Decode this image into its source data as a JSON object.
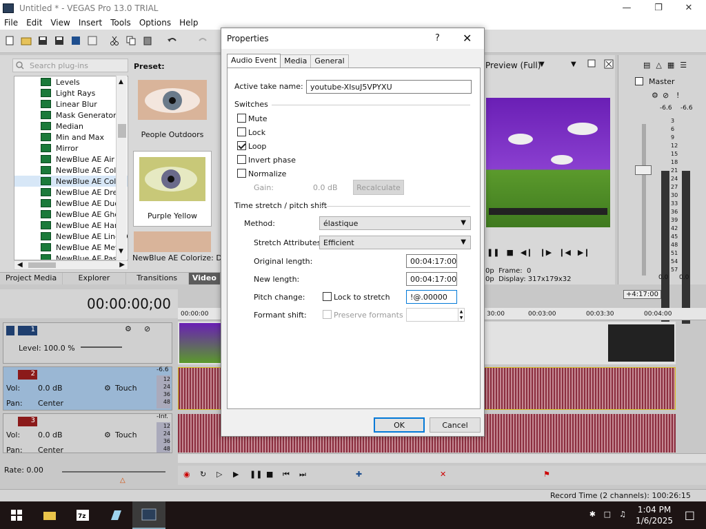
{
  "window": {
    "title": "Untitled * - VEGAS Pro 13.0 TRIAL"
  },
  "menu": [
    "File",
    "Edit",
    "View",
    "Insert",
    "Tools",
    "Options",
    "Help"
  ],
  "plugins": {
    "search_placeholder": "Search plug-ins",
    "items": [
      "Levels",
      "Light Rays",
      "Linear Blur",
      "Mask Generator",
      "Median",
      "Min and Max",
      "Mirror",
      "NewBlue AE Air Br",
      "NewBlue AE Color",
      "NewBlue AE Color",
      "NewBlue AE Drear",
      "NewBlue AE DuoC",
      "NewBlue AE Ghos",
      "NewBlue AE Hand",
      "NewBlue AE Line D",
      "NewBlue AE Metal",
      "NewBlue AE Paste"
    ],
    "selected_index": 9
  },
  "preset": {
    "label": "Preset:",
    "items": [
      "People Outdoors",
      "Purple Yellow"
    ],
    "status": "NewBlue AE Colorize: DXT,"
  },
  "left_tabs": [
    "Project Media",
    "Explorer",
    "Transitions",
    "Video"
  ],
  "preview": {
    "mode": "Preview (Full)",
    "line1": "0p  Frame:  0",
    "line2": "0p  Display: 317x179x32"
  },
  "master": {
    "label": "Master",
    "left_db": "-6.6",
    "right_db": "-6.6",
    "scale": [
      "3",
      "6",
      "9",
      "12",
      "15",
      "18",
      "21",
      "24",
      "27",
      "30",
      "33",
      "36",
      "39",
      "42",
      "45",
      "48",
      "51",
      "54",
      "57"
    ],
    "bottom_left": "0.0",
    "bottom_right": "0.0"
  },
  "timeline": {
    "timecode": "00:00:00;00",
    "end_marker": "+4:17:00",
    "ruler": [
      "00:00:00",
      "30:00",
      "00:03:00",
      "00:03:30",
      "00:04:00"
    ],
    "tracks": [
      {
        "num": "1",
        "level": "Level: 100.0 %"
      },
      {
        "num": "2",
        "vol": "Vol:",
        "vol_val": "0.0 dB",
        "pan": "Pan:",
        "pan_val": "Center",
        "mode": "Touch",
        "peak": "-6.6"
      },
      {
        "num": "3",
        "vol": "Vol:",
        "vol_val": "0.0 dB",
        "pan": "Pan:",
        "pan_val": "Center",
        "mode": "Touch",
        "peak": "-Inf."
      }
    ],
    "meter_marks": [
      "12",
      "24",
      "36",
      "48"
    ],
    "rate": "Rate: 0.00",
    "record_time": "Record Time (2 channels): 100:26:15"
  },
  "dialog": {
    "title": "Properties",
    "help": "?",
    "close": "✕",
    "tabs": [
      "Audio Event",
      "Media",
      "General"
    ],
    "active_take_label": "Active take name:",
    "active_take_value": "youtube-XIsuJ5VPYXU",
    "switches_label": "Switches",
    "switches": [
      {
        "label": "Mute",
        "checked": false
      },
      {
        "label": "Lock",
        "checked": false
      },
      {
        "label": "Loop",
        "checked": true
      },
      {
        "label": "Invert phase",
        "checked": false
      },
      {
        "label": "Normalize",
        "checked": false
      }
    ],
    "gain_label": "Gain:",
    "gain_value": "0.0 dB",
    "recalc": "Recalculate",
    "stretch_label": "Time stretch / pitch shift",
    "method_label": "Method:",
    "method_value": "élastique",
    "attrs_label": "Stretch Attributes:",
    "attrs_value": "Efficient",
    "orig_label": "Original length:",
    "orig_value": "00:04:17:00",
    "new_label": "New length:",
    "new_value": "00:04:17:00",
    "pitch_label": "Pitch change:",
    "lock_label": "Lock to stretch",
    "pitch_value": "!@.00000",
    "formant_label": "Formant shift:",
    "preserve_label": "Preserve formants",
    "ok": "OK",
    "cancel": "Cancel"
  },
  "taskbar": {
    "time": "1:04 PM",
    "date": "1/6/2025"
  }
}
